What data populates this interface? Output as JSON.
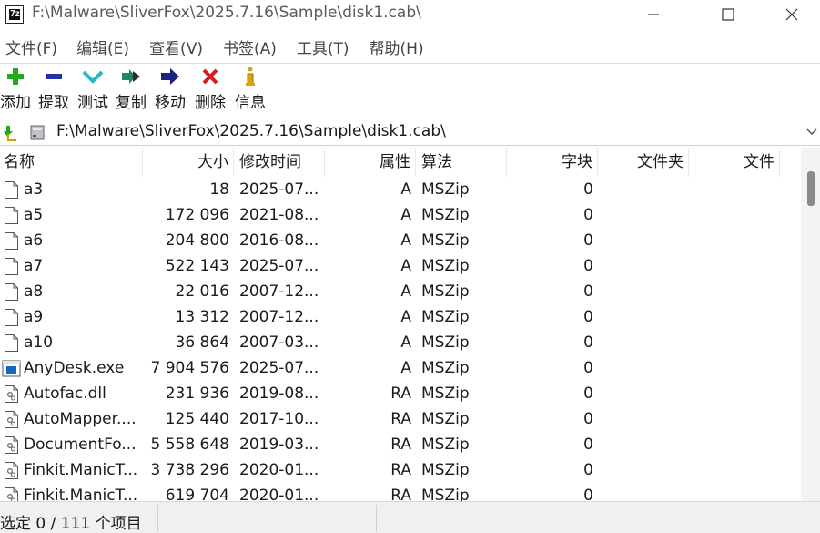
{
  "window": {
    "app_icon_text": "7z",
    "title": "F:\\Malware\\SliverFox\\2025.7.16\\Sample\\disk1.cab\\",
    "minimize_glyph": "—",
    "maximize_glyph": "☐",
    "close_glyph": "✕"
  },
  "menu": {
    "items": [
      "文件(F)",
      "编辑(E)",
      "查看(V)",
      "书签(A)",
      "工具(T)",
      "帮助(H)"
    ]
  },
  "toolbar": {
    "buttons": [
      {
        "label": "添加",
        "icon": "plus-icon",
        "color": "#1faa1f"
      },
      {
        "label": "提取",
        "icon": "minus-icon",
        "color": "#2233aa"
      },
      {
        "label": "测试",
        "icon": "check-icon",
        "color": "#22b8c8"
      },
      {
        "label": "复制",
        "icon": "double-arrow-icon",
        "color": "#1f8a5a"
      },
      {
        "label": "移动",
        "icon": "arrow-right-icon",
        "color": "#1a237e"
      },
      {
        "label": "删除",
        "icon": "delete-x-icon",
        "color": "#d32020"
      },
      {
        "label": "信息",
        "icon": "info-icon",
        "color": "#e0a400"
      }
    ]
  },
  "address": {
    "path": "F:\\Malware\\SliverFox\\2025.7.16\\Sample\\disk1.cab\\"
  },
  "columns": {
    "name": "名称",
    "size": "大小",
    "modified": "修改时间",
    "attributes": "属性",
    "method": "算法",
    "block": "字块",
    "folders": "文件夹",
    "files": "文件"
  },
  "rows": [
    {
      "name": "a3",
      "size": "18",
      "modified": "2025-07...",
      "attr": "A",
      "method": "MSZip",
      "block": "0",
      "icon": "file-icon"
    },
    {
      "name": "a5",
      "size": "172 096",
      "modified": "2021-08...",
      "attr": "A",
      "method": "MSZip",
      "block": "0",
      "icon": "file-icon"
    },
    {
      "name": "a6",
      "size": "204 800",
      "modified": "2016-08...",
      "attr": "A",
      "method": "MSZip",
      "block": "0",
      "icon": "file-icon"
    },
    {
      "name": "a7",
      "size": "522 143",
      "modified": "2025-07...",
      "attr": "A",
      "method": "MSZip",
      "block": "0",
      "icon": "file-icon"
    },
    {
      "name": "a8",
      "size": "22 016",
      "modified": "2007-12...",
      "attr": "A",
      "method": "MSZip",
      "block": "0",
      "icon": "file-icon"
    },
    {
      "name": "a9",
      "size": "13 312",
      "modified": "2007-12...",
      "attr": "A",
      "method": "MSZip",
      "block": "0",
      "icon": "file-icon"
    },
    {
      "name": "a10",
      "size": "36 864",
      "modified": "2007-03...",
      "attr": "A",
      "method": "MSZip",
      "block": "0",
      "icon": "file-icon"
    },
    {
      "name": "AnyDesk.exe",
      "size": "7 904 576",
      "modified": "2025-07...",
      "attr": "A",
      "method": "MSZip",
      "block": "0",
      "icon": "exe-icon"
    },
    {
      "name": "Autofac.dll",
      "size": "231 936",
      "modified": "2019-08...",
      "attr": "RA",
      "method": "MSZip",
      "block": "0",
      "icon": "dll-icon"
    },
    {
      "name": "AutoMapper....",
      "size": "125 440",
      "modified": "2017-10...",
      "attr": "RA",
      "method": "MSZip",
      "block": "0",
      "icon": "dll-icon"
    },
    {
      "name": "DocumentFo...",
      "size": "5 558 648",
      "modified": "2019-03...",
      "attr": "RA",
      "method": "MSZip",
      "block": "0",
      "icon": "dll-icon"
    },
    {
      "name": "Finkit.ManicT...",
      "size": "3 738 296",
      "modified": "2020-01...",
      "attr": "RA",
      "method": "MSZip",
      "block": "0",
      "icon": "dll-icon"
    },
    {
      "name": "Finkit.ManicT...",
      "size": "619 704",
      "modified": "2020-01...",
      "attr": "RA",
      "method": "MSZip",
      "block": "0",
      "icon": "dll-icon"
    }
  ],
  "status": {
    "selection": "选定 0 / 111 个项目"
  }
}
